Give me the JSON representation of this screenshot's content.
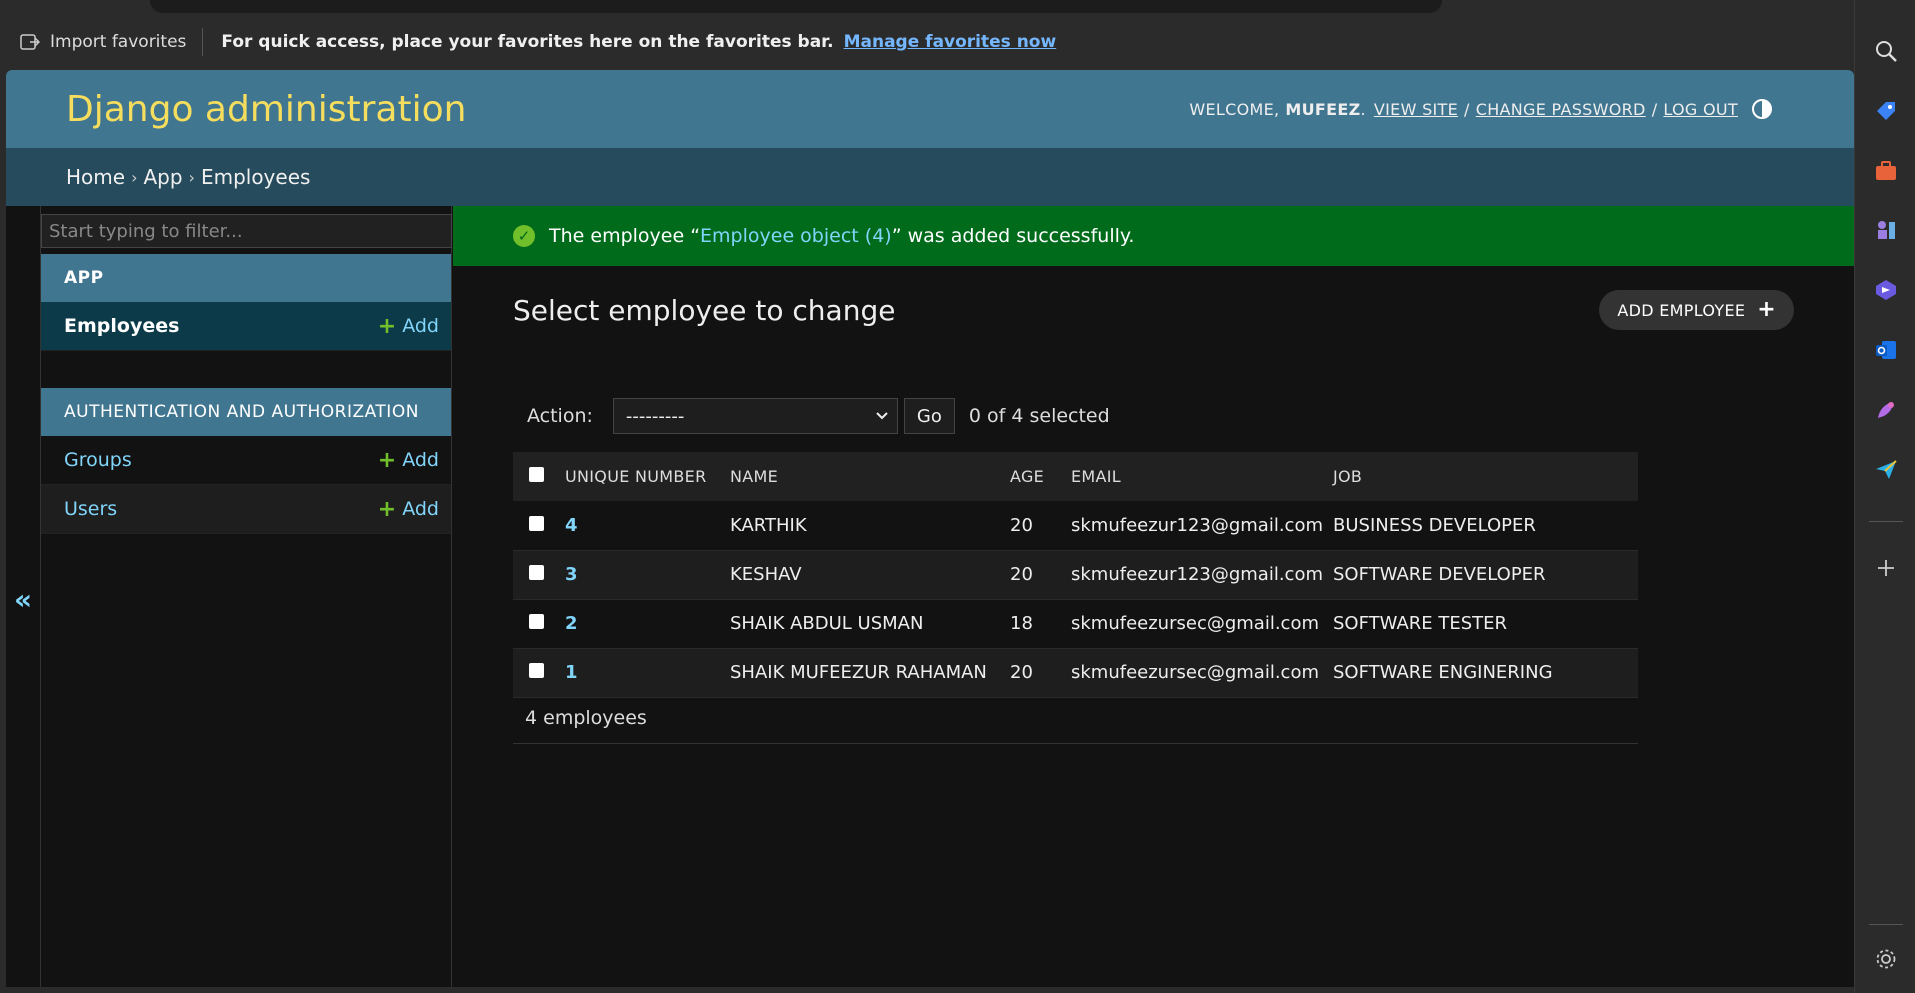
{
  "favorites": {
    "import_label": "Import favorites",
    "message": "For quick access, place your favorites here on the favorites bar.",
    "manage_link": "Manage favorites now"
  },
  "header": {
    "brand": "Django administration",
    "welcome": "WELCOME,",
    "username": "MUFEEZ",
    "view_site": "VIEW SITE",
    "change_password": "CHANGE PASSWORD",
    "log_out": "LOG OUT",
    "separator": "/"
  },
  "breadcrumb": {
    "home": "Home",
    "app": "App",
    "current": "Employees",
    "separator": "›"
  },
  "sidebar": {
    "filter_placeholder": "Start typing to filter...",
    "app_caption": "APP",
    "app_items": [
      {
        "label": "Employees",
        "add": "Add"
      }
    ],
    "auth_caption": "AUTHENTICATION AND AUTHORIZATION",
    "auth_items": [
      {
        "label": "Groups",
        "add": "Add"
      },
      {
        "label": "Users",
        "add": "Add"
      }
    ],
    "collapse_glyph": "«"
  },
  "message": {
    "prefix": "The employee “",
    "object": "Employee object (4)",
    "suffix": "” was added successfully."
  },
  "main": {
    "title": "Select employee to change",
    "add_button": "ADD EMPLOYEE",
    "action_label": "Action:",
    "action_selected": "---------",
    "go_label": "Go",
    "selected_count": "0 of 4 selected",
    "columns": [
      "UNIQUE NUMBER",
      "NAME",
      "AGE",
      "EMAIL",
      "JOB"
    ],
    "rows": [
      {
        "id": "4",
        "name": "KARTHIK",
        "age": "20",
        "email": "skmufeezur123@gmail.com",
        "job": "BUSINESS DEVELOPER"
      },
      {
        "id": "3",
        "name": "KESHAV",
        "age": "20",
        "email": "skmufeezur123@gmail.com",
        "job": "SOFTWARE DEVELOPER"
      },
      {
        "id": "2",
        "name": "SHAIK ABDUL USMAN",
        "age": "18",
        "email": "skmufeezursec@gmail.com",
        "job": "SOFTWARE TESTER"
      },
      {
        "id": "1",
        "name": "SHAIK MUFEEZUR RAHAMAN",
        "age": "20",
        "email": "skmufeezursec@gmail.com",
        "job": "SOFTWARE ENGINERING"
      }
    ],
    "paginator": "4 employees"
  },
  "colors": {
    "header": "#417690",
    "breadcrumb": "#264b5d",
    "success": "#006b1b",
    "brand": "#f5dd5d",
    "link": "#81d4fa",
    "add_green": "#70bf2b"
  },
  "edge_icons": [
    "search-icon",
    "tag-icon",
    "briefcase-icon",
    "chess-icon",
    "copilot-icon",
    "outlook-icon",
    "designer-icon",
    "send-icon",
    "plus-icon",
    "settings-icon"
  ]
}
